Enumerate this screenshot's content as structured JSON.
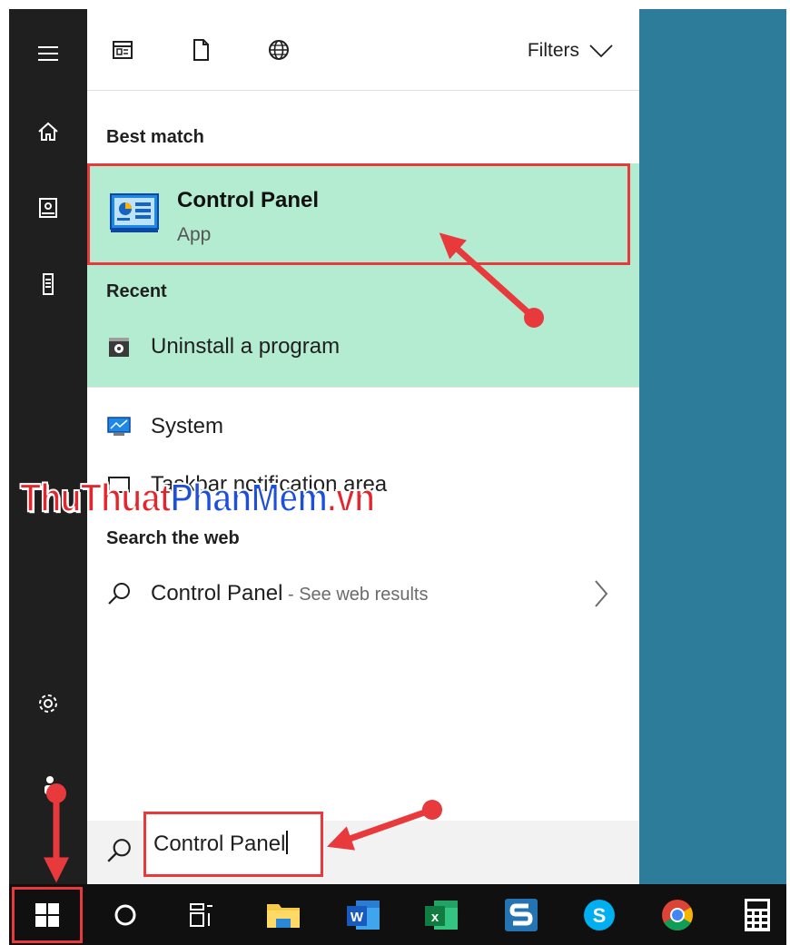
{
  "toolbar": {
    "filters_label": "Filters"
  },
  "sections": {
    "best_match": "Best match",
    "recent": "Recent",
    "search_web": "Search the web"
  },
  "best_match": {
    "title": "Control Panel",
    "subtitle": "App"
  },
  "recent_items": [
    {
      "label": "Uninstall a program"
    }
  ],
  "settings_items": [
    {
      "label": "System"
    },
    {
      "label": "Taskbar notification area"
    }
  ],
  "web_result": {
    "label": "Control Panel",
    "sub": " - See web results"
  },
  "search": {
    "value": "Control Panel"
  },
  "watermark": {
    "part1": "ThuThuat",
    "part2": "PhanMem",
    "part3": ".vn"
  },
  "taskbar": {
    "items": [
      "start-icon",
      "cortana-icon",
      "task-view-icon",
      "file-explorer-icon",
      "word-icon",
      "excel-icon",
      "snagit-icon",
      "skype-icon",
      "chrome-icon",
      "calculator-icon"
    ]
  },
  "colors": {
    "highlight_bg": "#b3ecd0",
    "annotation_red": "#e8393d",
    "desktop": "#2d7d9a"
  }
}
